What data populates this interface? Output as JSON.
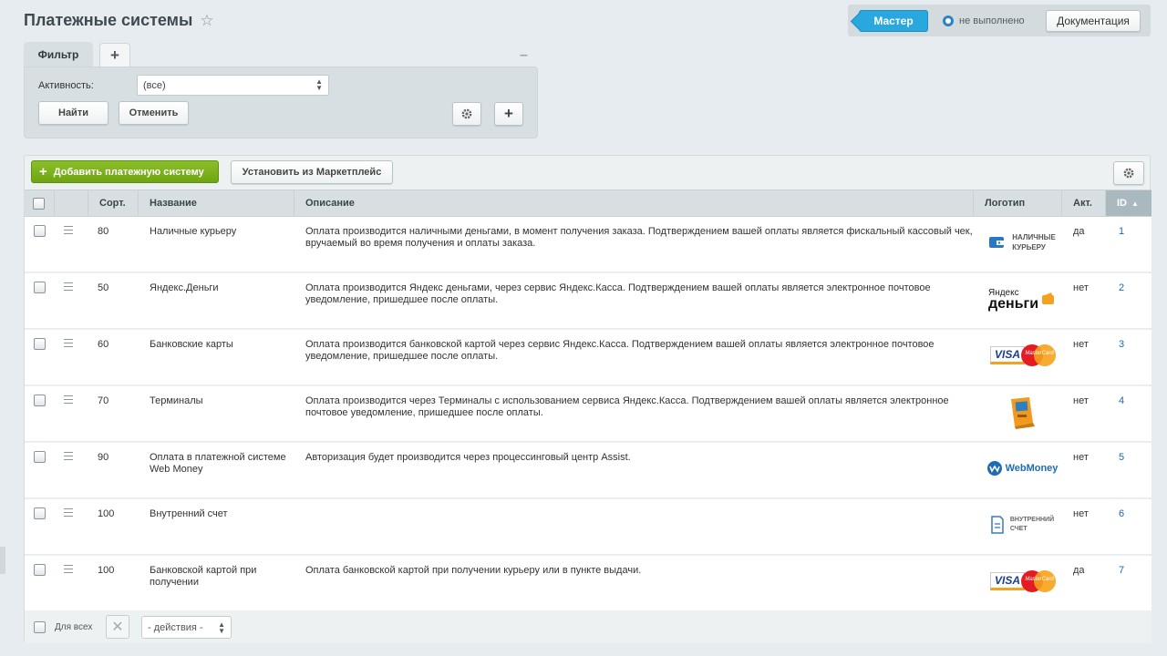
{
  "page": {
    "title": "Платежные системы"
  },
  "top_bar": {
    "master_label": "Мастер",
    "status_text": "не выполнено",
    "doc_label": "Документация"
  },
  "filter": {
    "tab_label": "Фильтр",
    "activity_label": "Активность:",
    "activity_value": "(все)",
    "find_label": "Найти",
    "cancel_label": "Отменить"
  },
  "toolbar": {
    "add_label": "Добавить платежную систему",
    "market_label": "Установить из Маркетплейс"
  },
  "table": {
    "headers": {
      "sort": "Сорт.",
      "name": "Название",
      "description": "Описание",
      "logo": "Логотип",
      "active": "Акт.",
      "id": "ID"
    },
    "rows": [
      {
        "sort": "80",
        "name": "Наличные курьеру",
        "description": "Оплата производится наличными деньгами, в момент получения заказа. Подтверждением вашей оплаты является фискальный кассовый чек, вручаемый во время получения и оплаты заказа.",
        "active": "да",
        "id": "1",
        "logo": {
          "icon": "cash-courier-logo",
          "text_line1": "НАЛИЧНЫЕ",
          "text_line2": "КУРЬЕРУ"
        }
      },
      {
        "sort": "50",
        "name": "Яндекс.Деньги",
        "description": "Оплата производится Яндекс деньгами, через сервис Яндекс.Касса. Подтверждением вашей оплаты является электронное почтовое уведомление, пришедшее после оплаты.",
        "active": "нет",
        "id": "2",
        "logo": {
          "icon": "yandex-money-logo",
          "text_line1": "Яндекс",
          "text_line2": "деньги"
        }
      },
      {
        "sort": "60",
        "name": "Банковские карты",
        "description": "Оплата производится банковской картой через сервис Яндекс.Касса. Подтверждением вашей оплаты является электронное почтовое уведомление, пришедшее после оплаты.",
        "active": "нет",
        "id": "3",
        "logo": {
          "icon": "visa-mastercard-logo",
          "text_line1": "VISA",
          "text_line2": "MasterCard"
        }
      },
      {
        "sort": "70",
        "name": "Терминалы",
        "description": "Оплата производится через Терминалы с использованием сервиса Яндекс.Касса. Подтверждением вашей оплаты является электронное почтовое уведомление, пришедшее после оплаты.",
        "active": "нет",
        "id": "4",
        "logo": {
          "icon": "terminal-logo"
        }
      },
      {
        "sort": "90",
        "name": "Оплата в платежной системе Web Money",
        "description": "Авторизация будет производится через процессинговый центр Assist.",
        "active": "нет",
        "id": "5",
        "logo": {
          "icon": "webmoney-logo",
          "text_line1": "WebMoney"
        }
      },
      {
        "sort": "100",
        "name": "Внутренний счет",
        "description": "",
        "active": "нет",
        "id": "6",
        "logo": {
          "icon": "internal-account-logo",
          "text_line1": "ВНУТРЕННИЙ",
          "text_line2": "СЧЕТ"
        }
      },
      {
        "sort": "100",
        "name": "Банковской картой при получении",
        "description": "Оплата банковской картой при получении курьеру или в пункте выдачи.",
        "active": "да",
        "id": "7",
        "logo": {
          "icon": "visa-mastercard-logo",
          "text_line1": "VISA",
          "text_line2": "MasterCard"
        }
      }
    ]
  },
  "footer": {
    "for_all_label": "Для всех",
    "actions_value": "- действия -"
  },
  "colors": {
    "accent_blue": "#29a8e0",
    "add_green": "#7cb21f",
    "link_blue": "#2067b0",
    "header_bg": "#d8dfe2"
  }
}
